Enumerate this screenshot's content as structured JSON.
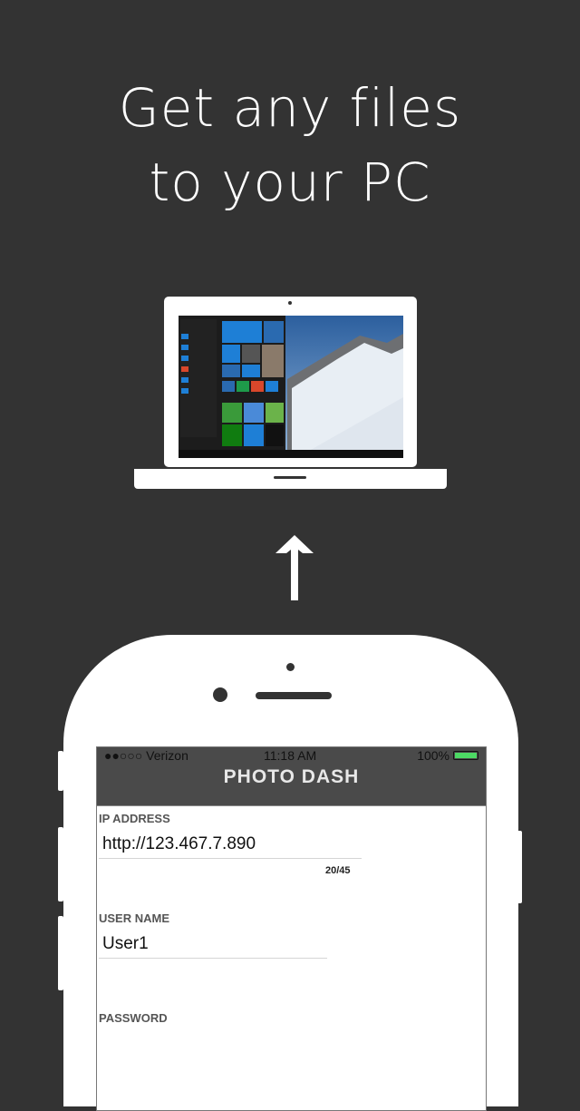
{
  "headline": {
    "line1": "Get any files",
    "line2": "to your PC"
  },
  "laptop": {
    "screen_icon": "windows-desktop-screenshot",
    "colors": {
      "sky": "#3f72b0",
      "snow": "#e8eef4",
      "start_menu": "#222222",
      "tile": "#1e7fd6"
    }
  },
  "arrow": {
    "icon": "arrow-up-icon",
    "color": "#ffffff"
  },
  "phone": {
    "status_bar": {
      "carrier": "●●○○○ Verizon",
      "time": "11:18 AM",
      "battery": "100%",
      "battery_level": 1.0
    },
    "app_title": "PHOTO DASH",
    "form": {
      "ip_label": "IP ADDRESS",
      "ip_value": "http://123.467.7.890",
      "ip_counter": "20/45",
      "user_label": "USER NAME",
      "user_value": "User1",
      "password_label": "PASSWORD"
    }
  },
  "colors": {
    "background": "#333333",
    "device": "#ffffff",
    "app_bar": "#4a4a4a"
  }
}
